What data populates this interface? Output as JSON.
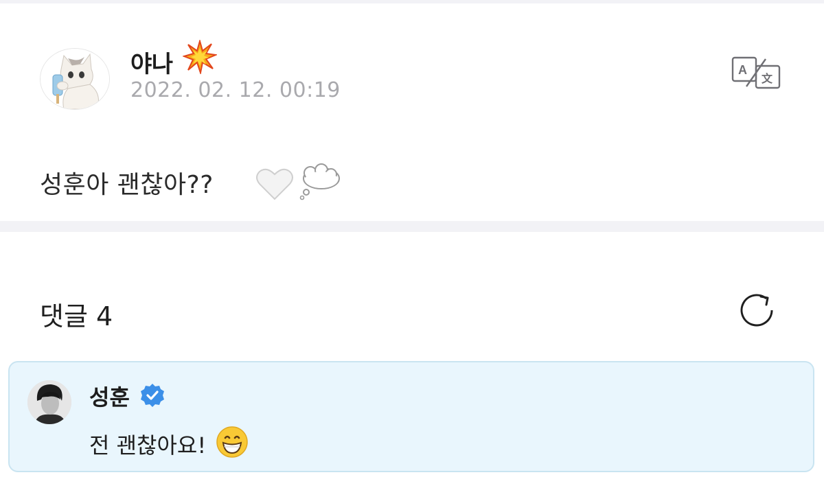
{
  "post": {
    "author": "야나",
    "author_emoji": "collision-icon",
    "date": "2022. 02. 12. 00:19",
    "body": "성훈아 괜찮아??",
    "body_icons": [
      "white-heart-icon",
      "thought-balloon-icon"
    ],
    "translate_icon": "translate-icon"
  },
  "comments": {
    "label": "댓글 4",
    "refresh_icon": "refresh-icon"
  },
  "comment_list": [
    {
      "author": "성훈",
      "verified_icon": "verified-badge-icon",
      "text": "전 괜찮아요!",
      "emoji": "grinning-face-icon"
    }
  ],
  "colors": {
    "divider": "#f2f2f6",
    "date_text": "#a9a9ad",
    "highlight_bg": "#e9f6fd",
    "highlight_border": "#c9e4f1",
    "verified_blue": "#3b8fe8"
  }
}
